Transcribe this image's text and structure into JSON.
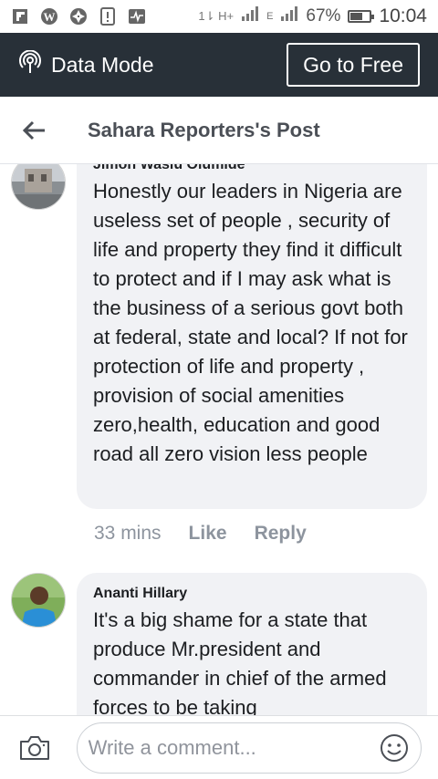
{
  "status_bar": {
    "icons": [
      "flipboard-icon",
      "wordpress-icon",
      "aperture-icon",
      "notification-icon",
      "activity-icon"
    ],
    "network_label": "1⇂ H+",
    "signal_label": "E",
    "battery_percent": "67%",
    "battery_level": 0.67,
    "time": "10:04"
  },
  "data_bar": {
    "label": "Data Mode",
    "go_free_label": "Go to Free"
  },
  "header": {
    "title": "Sahara Reporters's Post"
  },
  "comments": [
    {
      "author": "Jimoh Wasiu Olumide",
      "text": "Honestly our leaders in Nigeria are useless set of people , security of life and property they find it difficult to protect and if I may ask what is the business of a serious govt both at federal, state and local? If not for protection of life and property , provision of social amenities zero,health, education and good road all zero vision less people",
      "time": "33 mins",
      "like_label": "Like",
      "reply_label": "Reply"
    },
    {
      "author": "Ananti Hillary",
      "text": "It's a big shame for a state that produce Mr.president and commander in chief of  the armed forces to be taking"
    }
  ],
  "footer": {
    "placeholder": "Write a comment..."
  },
  "colors": {
    "data_bar_bg": "#283038",
    "bubble_bg": "#f1f2f5",
    "meta_text": "#8d949e"
  }
}
